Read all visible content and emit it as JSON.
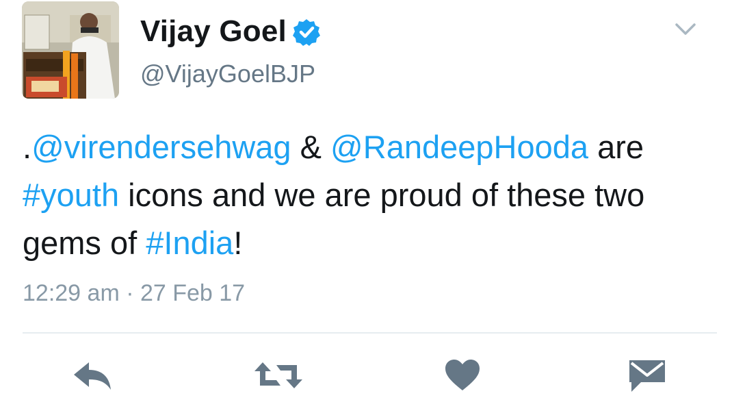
{
  "tweet": {
    "author": {
      "display_name": "Vijay Goel",
      "handle": "@VijayGoelBJP",
      "verified": true,
      "avatar_icon": "profile-photo"
    },
    "text_parts": [
      {
        "text": ".",
        "type": "text"
      },
      {
        "text": "@virendersehwag",
        "type": "mention"
      },
      {
        "text": " & ",
        "type": "text"
      },
      {
        "text": "@RandeepHooda",
        "type": "mention"
      },
      {
        "text": " are ",
        "type": "text"
      },
      {
        "text": "#youth",
        "type": "hashtag"
      },
      {
        "text": " icons and we are proud of these two gems of ",
        "type": "text"
      },
      {
        "text": "#India",
        "type": "hashtag"
      },
      {
        "text": "!",
        "type": "text"
      }
    ],
    "timestamp": "12:29 am · 27 Feb 17"
  },
  "actions": {
    "reply_icon": "reply-icon",
    "retweet_icon": "retweet-icon",
    "like_icon": "heart-icon",
    "dm_icon": "envelope-icon",
    "menu_icon": "chevron-down-icon"
  },
  "colors": {
    "link": "#1da1f2",
    "text": "#14171a",
    "muted": "#8899a6",
    "icon": "#657786",
    "verified": "#1da1f2"
  }
}
